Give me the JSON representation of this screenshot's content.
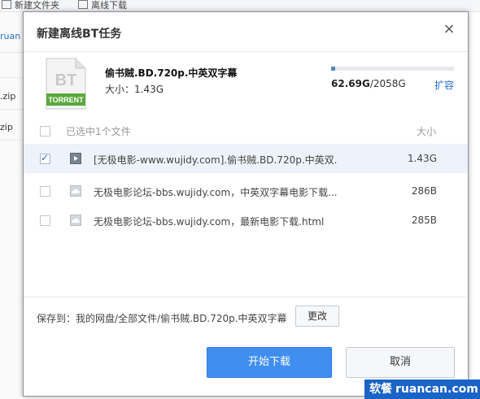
{
  "toolbar": {
    "new_folder": "新建文件夹",
    "offline_download": "离线下载"
  },
  "background": {
    "item1": "ruan",
    "item2": ".zip",
    "item3": "zip"
  },
  "dialog": {
    "title": "新建离线BT任务",
    "close": "×",
    "torrent_icon_text_top": "BT",
    "torrent_icon_text_bottom": "TORRENT",
    "file_name": "偷书贼.BD.720p.中英双字幕",
    "size_label": "大小：1.43G",
    "quota_used": "62.69G",
    "quota_total": "/2058G",
    "quota_fraction": 0.0305,
    "expand": "扩容",
    "selected_summary": "已选中1个文件",
    "size_header": "大小",
    "files": [
      {
        "name": "[无极电影-www.wujidy.com].偷书贼.BD.720p.中英双...",
        "size": "1.43G",
        "checked": true,
        "icon": "video-file-icon"
      },
      {
        "name": "无极电影论坛-bbs.wujidy.com，中英双字幕电影下载....",
        "size": "286B",
        "checked": false,
        "icon": "cloud-file-icon"
      },
      {
        "name": "无极电影论坛-bbs.wujidy.com，最新电影下载.html",
        "size": "285B",
        "checked": false,
        "icon": "cloud-file-icon"
      }
    ],
    "save_to": "保存到：我的网盘/全部文件/偷书贼.BD.720p.中英双字幕",
    "change": "更改",
    "start": "开始下载",
    "cancel": "取消"
  },
  "watermark": {
    "cn": "软餐",
    "en": "ruancan.com"
  },
  "colors": {
    "primary": "#3f8ef0",
    "link": "#2a6fc9",
    "selected_row": "#eef3fb",
    "torrent_green": "#5aa83a"
  }
}
